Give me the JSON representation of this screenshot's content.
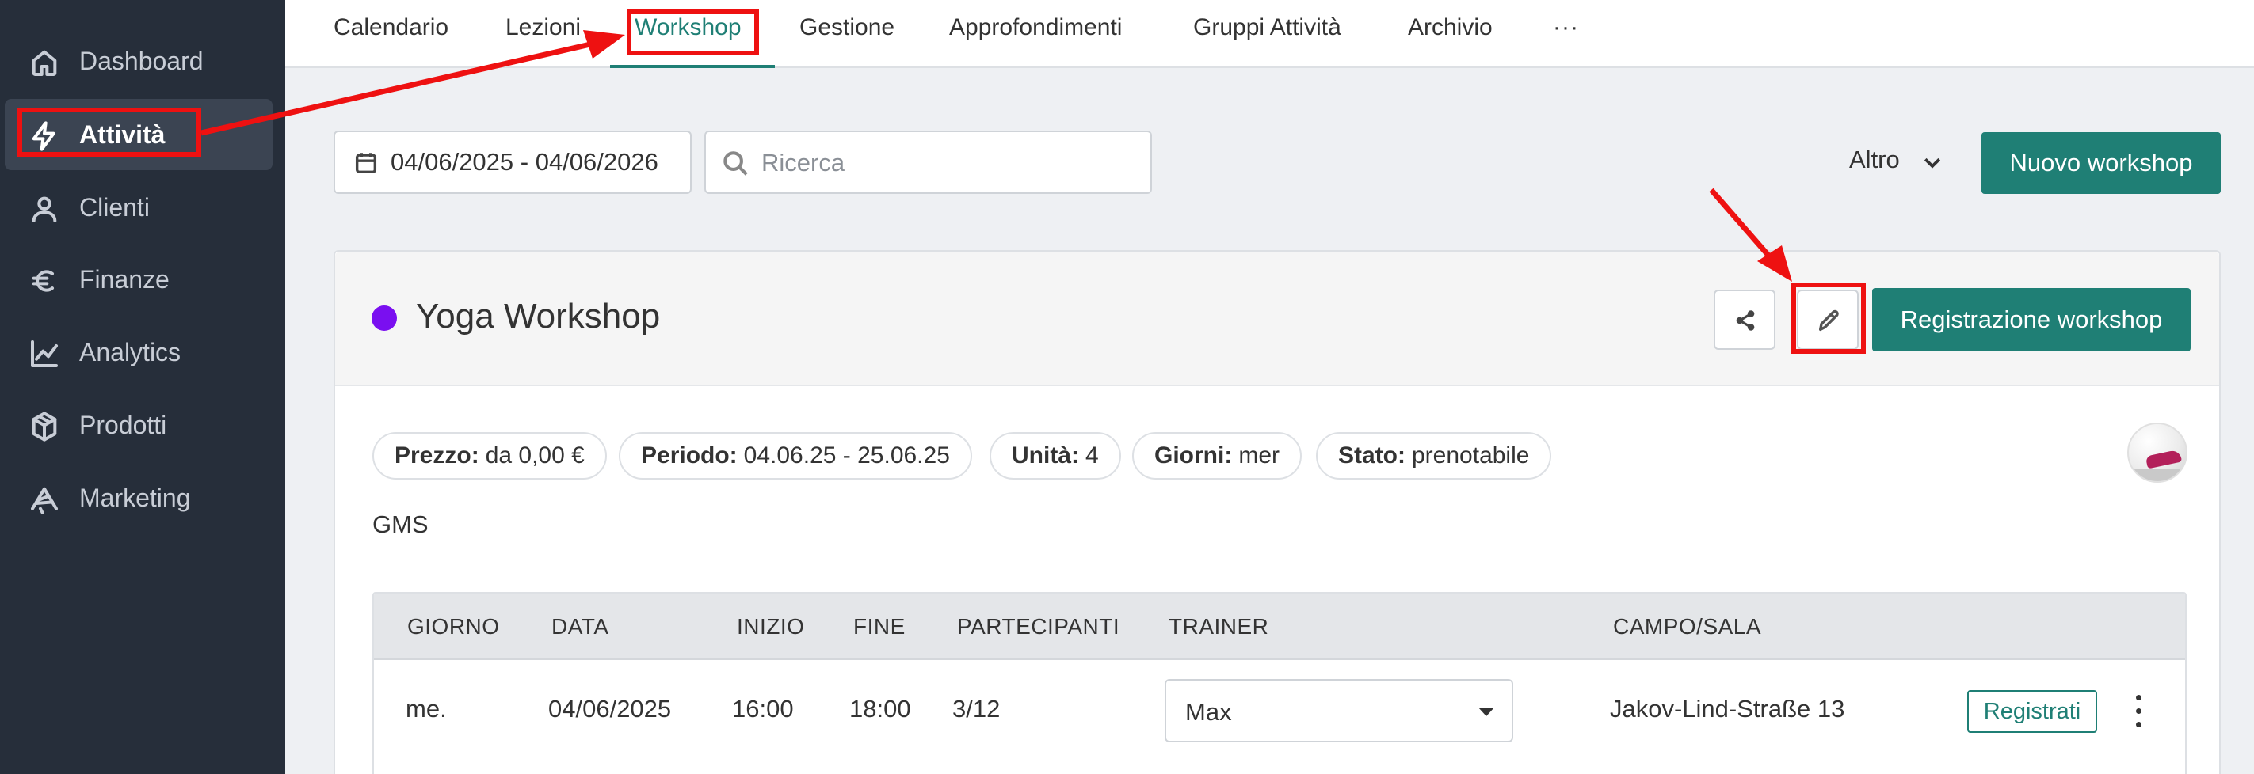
{
  "sidebar": {
    "items": [
      {
        "label": "Dashboard",
        "icon": "home-icon"
      },
      {
        "label": "Attività",
        "icon": "bolt-icon"
      },
      {
        "label": "Clienti",
        "icon": "user-icon"
      },
      {
        "label": "Finanze",
        "icon": "euro-icon"
      },
      {
        "label": "Analytics",
        "icon": "chart-line-icon"
      },
      {
        "label": "Prodotti",
        "icon": "box-icon"
      },
      {
        "label": "Marketing",
        "icon": "megaphone-icon"
      }
    ],
    "active": "Attività"
  },
  "topnav": {
    "tabs": [
      {
        "label": "Calendario"
      },
      {
        "label": "Lezioni"
      },
      {
        "label": "Workshop"
      },
      {
        "label": "Gestione"
      },
      {
        "label": "Approfondimenti"
      },
      {
        "label": "Gruppi Attività"
      },
      {
        "label": "Archivio"
      }
    ],
    "active": "Workshop",
    "more": "···"
  },
  "toolbar": {
    "date_range": "04/06/2025 - 04/06/2026",
    "search_placeholder": "Ricerca",
    "more_label": "Altro",
    "new_button": "Nuovo workshop"
  },
  "workshop": {
    "title": "Yoga Workshop",
    "color": "#7a0ff0",
    "register_button": "Registrazione workshop",
    "info": [
      {
        "key": "Prezzo:",
        "value": "da 0,00 €"
      },
      {
        "key": "Periodo:",
        "value": "04.06.25 - 25.06.25"
      },
      {
        "key": "Unità:",
        "value": "4"
      },
      {
        "key": "Giorni:",
        "value": "mer"
      },
      {
        "key": "Stato:",
        "value": "prenotabile"
      }
    ],
    "description": "GMS",
    "table": {
      "columns": [
        "GIORNO",
        "DATA",
        "INIZIO",
        "FINE",
        "PARTECIPANTI",
        "TRAINER",
        "CAMPO/SALA"
      ],
      "rows": [
        {
          "giorno": "me.",
          "data": "04/06/2025",
          "inizio": "16:00",
          "fine": "18:00",
          "partecipanti": "3/12",
          "trainer": "Max",
          "campo": "Jakov-Lind-Straße 13",
          "action": "Registrati"
        }
      ]
    }
  },
  "colors": {
    "accent": "#1f7f75",
    "sidebar_bg": "#262e3a",
    "annotation": "#ee1111"
  }
}
